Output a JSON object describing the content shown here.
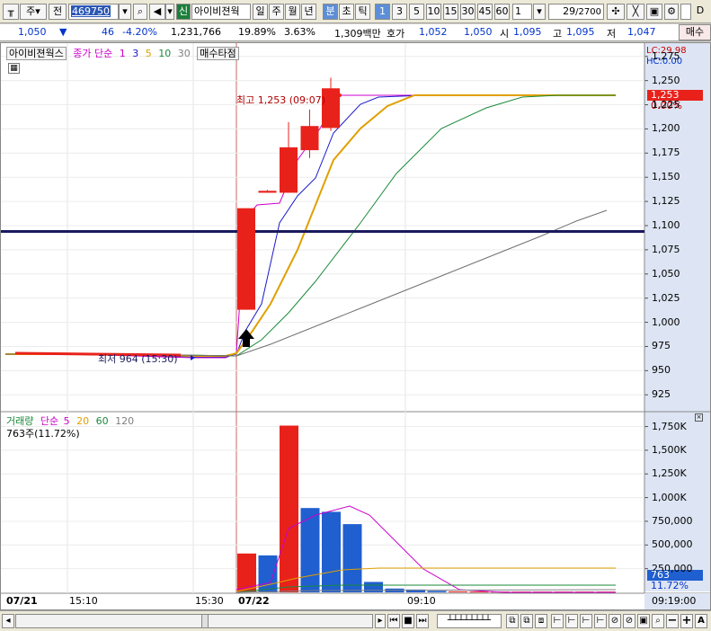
{
  "toolbar": {
    "period_mode": "주",
    "prev_label": "전",
    "code": "469750",
    "badge": "신",
    "stock_name": "아이비젼웍",
    "periods": [
      "일",
      "주",
      "월",
      "년",
      "분",
      "초",
      "틱"
    ],
    "active_period": "분",
    "minutes": [
      "1",
      "3",
      "5",
      "10",
      "15",
      "30",
      "45",
      "60"
    ],
    "active_minute": "1",
    "interval_value": "1",
    "page_count": "29",
    "page_total": "/2700"
  },
  "info": {
    "price": "1,050",
    "change_arrow": "▼",
    "change": "46",
    "change_pct": "-4.20%",
    "volume": "1,231,766",
    "turnover_pct": "19.89%",
    "ratio_pct": "3.63%",
    "amount": "1,309백만",
    "bid_label": "호가",
    "bid1": "1,052",
    "bid2": "1,050",
    "open_label": "시",
    "open": "1,095",
    "high_label": "고",
    "high": "1,095",
    "low_label": "저",
    "low": "1,047",
    "buy_label": "매수"
  },
  "price_panel": {
    "name_tag": "아이비젼웍스",
    "ma_title": "종가 단순",
    "ma_periods": [
      "1",
      "3",
      "5",
      "10",
      "30"
    ],
    "ma_colors": [
      "#cc00cc",
      "#1a1acc",
      "#e0a000",
      "#1a8a3a",
      "#808080"
    ],
    "marker_label": "매수타점",
    "lc": "LC:29.98",
    "hc": "HC:0.00",
    "high_note": "최고 1,253 (09:07)",
    "low_note": "최저 964 (15:30)",
    "price_badge": "1,253",
    "price_pct": "0.00%",
    "y_ticks": [
      "1,275",
      "1,250",
      "1,225",
      "1,200",
      "1,175",
      "1,150",
      "1,125",
      "1,100",
      "1,075",
      "1,050",
      "1,025",
      "1,000",
      "975",
      "950",
      "925"
    ]
  },
  "volume_panel": {
    "title": "거래량",
    "ma_title": "단순",
    "ma_periods": [
      "5",
      "20",
      "60",
      "120"
    ],
    "ma_colors": [
      "#cc00cc",
      "#e0a000",
      "#1a8a3a",
      "#808080"
    ],
    "current": "763주(11.72%)",
    "y_ticks": [
      "1,750K",
      "1,500K",
      "1,250K",
      "1,000K",
      "750,000",
      "500,000",
      "250,000"
    ],
    "badge_value": "763",
    "badge_pct": "11.72%"
  },
  "x_axis": {
    "labels": [
      "07/21",
      "15:10",
      "15:30",
      "07/22",
      "09:10"
    ],
    "time_box": "09:19:00"
  },
  "chart_data": {
    "type": "candlestick",
    "candles": [
      {
        "o": 1013,
        "h": 1118,
        "l": 1013,
        "c": 1118
      },
      {
        "o": 1134,
        "h": 1137,
        "l": 1134,
        "c": 1136
      },
      {
        "o": 1134,
        "h": 1207,
        "l": 1134,
        "c": 1181
      },
      {
        "o": 1178,
        "h": 1220,
        "l": 1170,
        "c": 1203
      },
      {
        "o": 1201,
        "h": 1253,
        "l": 1198,
        "c": 1242
      }
    ],
    "volume": [
      {
        "v": 410000,
        "color": "#e8221b"
      },
      {
        "v": 390000,
        "color": "#1f5fcf"
      },
      {
        "v": 1760000,
        "color": "#e8221b"
      },
      {
        "v": 890000,
        "color": "#1f5fcf"
      },
      {
        "v": 850000,
        "color": "#1f5fcf"
      },
      {
        "v": 720000,
        "color": "#1f5fcf"
      },
      {
        "v": 110000,
        "color": "#1f5fcf"
      },
      {
        "v": 40000,
        "color": "#1f5fcf"
      },
      {
        "v": 30000,
        "color": "#1f5fcf"
      },
      {
        "v": 15000,
        "color": "#1f5fcf"
      },
      {
        "v": 10000,
        "color": "#e8221b"
      },
      {
        "v": 8000,
        "color": "#e8221b"
      },
      {
        "v": 8000,
        "color": "#e8221b"
      },
      {
        "v": 8000,
        "color": "#e8221b"
      },
      {
        "v": 8000,
        "color": "#e8221b"
      },
      {
        "v": 8000,
        "color": "#e8221b"
      },
      {
        "v": 8000,
        "color": "#e8221b"
      },
      {
        "v": 8000,
        "color": "#e8221b"
      }
    ],
    "hline_price": 1094,
    "ylim_price": [
      915,
      1285
    ],
    "ylim_volume": [
      0,
      1850000
    ]
  }
}
